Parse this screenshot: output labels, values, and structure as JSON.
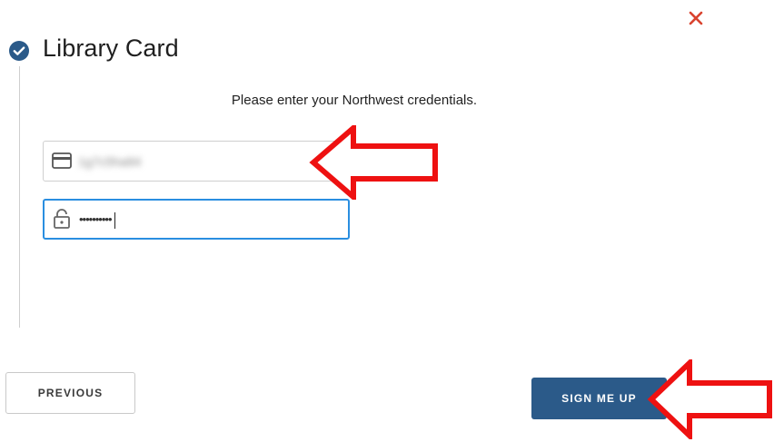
{
  "dialog": {
    "close_symbol": "✕",
    "close_color": "#d9432f"
  },
  "step": {
    "title": "Library Card",
    "check_color": "#2b5a89"
  },
  "form": {
    "instructions": "Please enter your Northwest credentials.",
    "card_field": {
      "value": "1g7c5ha84",
      "icon": "credit-card-icon"
    },
    "password_field": {
      "value": "••••••••••",
      "icon": "lock-icon",
      "focused": true,
      "focus_color": "#2a8ee0"
    }
  },
  "footer": {
    "previous_label": "PREVIOUS",
    "sign_up_label": "SIGN ME UP",
    "primary_color": "#2b5a89"
  },
  "annotations": {
    "arrow_color": "#ee1111"
  }
}
